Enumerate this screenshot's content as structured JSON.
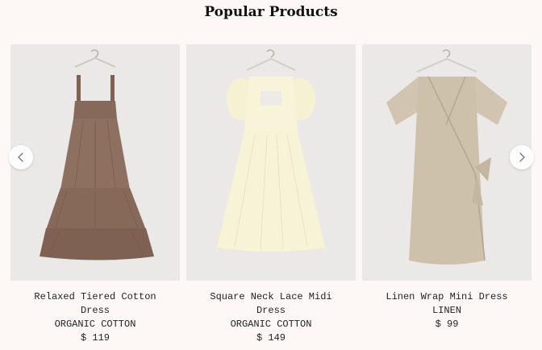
{
  "section": {
    "title": "Popular Products"
  },
  "carousel": {
    "prev_icon": "chevron-left-icon",
    "next_icon": "chevron-right-icon"
  },
  "products": [
    {
      "name": "Relaxed Tiered Cotton Dress",
      "material": "ORGANIC COTTON",
      "price": "$ 119",
      "image": "brown-tiered-dress-image",
      "color": "#8a6d5b"
    },
    {
      "name": "Square Neck Lace Midi Dress",
      "material": "ORGANIC COTTON",
      "price": "$ 149",
      "image": "cream-puff-sleeve-dress-image",
      "color": "#f7f3d8"
    },
    {
      "name": "Linen Wrap Mini Dress",
      "material": "LINEN",
      "price": "$ 99",
      "image": "beige-wrap-dress-image",
      "color": "#cfc2ad"
    }
  ]
}
